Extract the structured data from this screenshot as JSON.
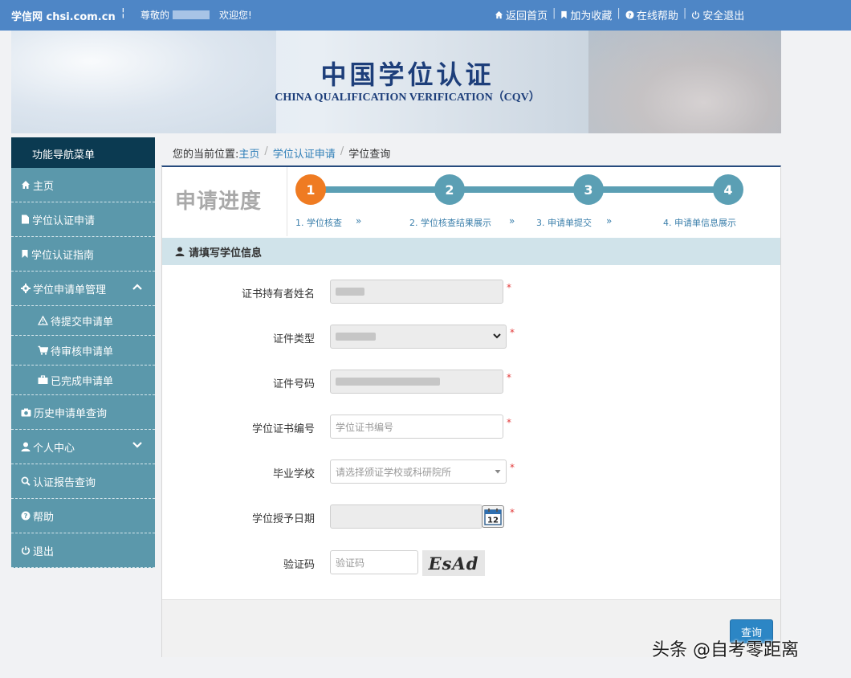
{
  "topbar": {
    "brand": "学信网 chsi.com.cn",
    "separator": "¦",
    "greet_prefix": "尊敬的",
    "greet_suffix": "欢迎您!",
    "links": [
      "返回首页",
      "加为收藏",
      "在线帮助",
      "安全退出"
    ],
    "bg_color": "#4e86c6"
  },
  "banner": {
    "title": "中国学位认证",
    "subtitle": "CHINA QUALIFICATION VERIFICATION（CQV）"
  },
  "sidebar": {
    "heading": "功能导航菜单",
    "items": [
      {
        "label": "主页",
        "icon": "home-icon"
      },
      {
        "label": "学位认证申请",
        "icon": "file-icon"
      },
      {
        "label": "学位认证指南",
        "icon": "bookmark-icon"
      },
      {
        "label": "学位申请单管理",
        "icon": "gear-icon",
        "expanded": true
      },
      {
        "label": "待提交申请单",
        "icon": "warning-icon",
        "sub": true
      },
      {
        "label": "待审核申请单",
        "icon": "cart-icon",
        "sub": true
      },
      {
        "label": "已完成申请单",
        "icon": "briefcase-icon",
        "sub": true
      },
      {
        "label": "历史申请单查询",
        "icon": "camera-icon"
      },
      {
        "label": "个人中心",
        "icon": "user-icon",
        "expanded": false
      },
      {
        "label": "认证报告查询",
        "icon": "search-icon"
      },
      {
        "label": "帮助",
        "icon": "question-icon"
      },
      {
        "label": "退出",
        "icon": "power-icon"
      }
    ],
    "bg_color": "#5b98ab",
    "head_color": "#0b3a51"
  },
  "breadcrumb": {
    "prefix": "您的当前位置:",
    "items": [
      "主页",
      "学位认证申请",
      "学位查询"
    ]
  },
  "progress": {
    "title": "申请进度",
    "steps": [
      {
        "num": "1",
        "label": "1. 学位核查",
        "active": true
      },
      {
        "num": "2",
        "label": "2. 学位核查结果展示",
        "active": false
      },
      {
        "num": "3",
        "label": "3. 申请单提交",
        "active": false
      },
      {
        "num": "4",
        "label": "4. 申请单信息展示",
        "active": false
      }
    ],
    "arrow": "»",
    "active_color": "#ef7b22",
    "step_color": "#5b9fb4"
  },
  "form": {
    "section_title": "请填写学位信息",
    "fields": [
      {
        "label": "证书持有者姓名",
        "type": "text",
        "value": "",
        "placeholder": "",
        "required": true
      },
      {
        "label": "证件类型",
        "type": "select",
        "value": "",
        "placeholder": "",
        "required": true
      },
      {
        "label": "证件号码",
        "type": "text",
        "value": "",
        "placeholder": "",
        "required": true
      },
      {
        "label": "学位证书编号",
        "type": "text",
        "value": "",
        "placeholder": "学位证书编号",
        "required": true
      },
      {
        "label": "毕业学校",
        "type": "select",
        "value": "",
        "placeholder": "请选择颁证学校或科研院所",
        "required": true
      },
      {
        "label": "学位授予日期",
        "type": "date",
        "value": "",
        "placeholder": "",
        "required": true
      },
      {
        "label": "验证码",
        "type": "captcha",
        "value": "",
        "placeholder": "验证码",
        "required": false
      }
    ],
    "required_mark": "*",
    "captcha_text": "EsAd",
    "calendar_day": "12",
    "submit_label": "查询"
  },
  "watermark": "头条 @自考零距离"
}
